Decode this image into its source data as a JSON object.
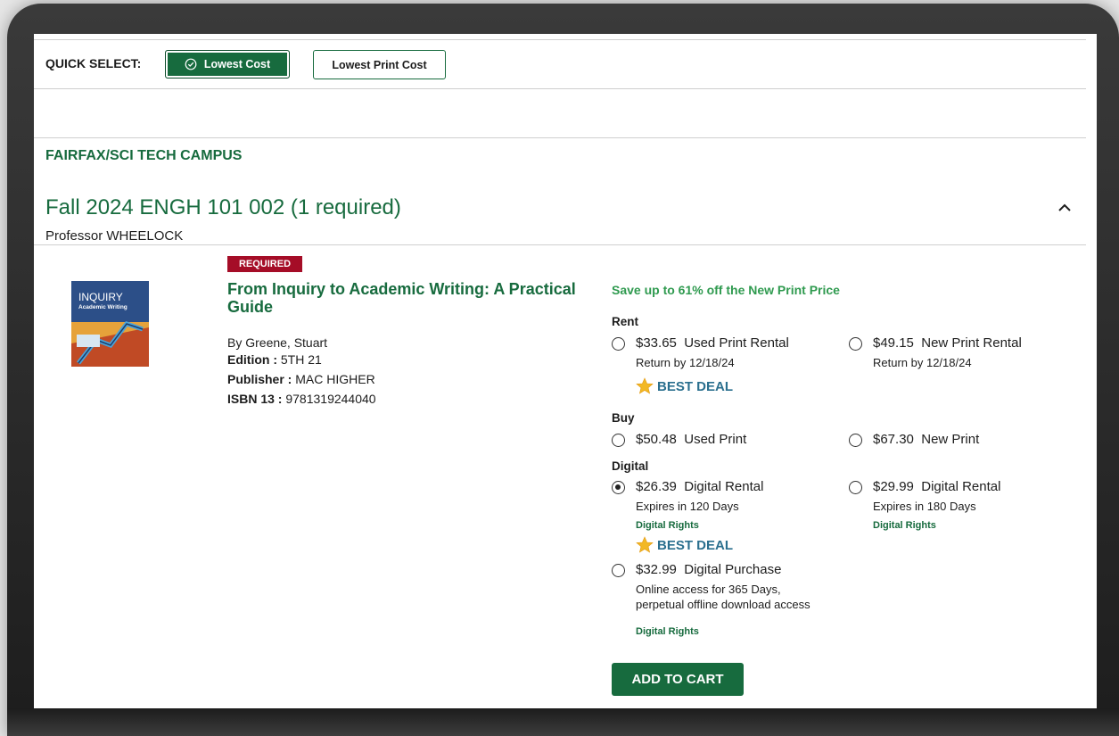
{
  "quick_select": {
    "label": "QUICK SELECT:",
    "lowest_cost_label": "Lowest Cost",
    "lowest_print_label": "Lowest Print Cost"
  },
  "campus": "FAIRFAX/SCI TECH CAMPUS",
  "course": {
    "title": "Fall 2024 ENGH 101 002 (1 required)",
    "professor": "Professor WHEELOCK"
  },
  "book": {
    "badge": "REQUIRED",
    "cover_title": "INQUIRY",
    "cover_subtitle": "Academic Writing",
    "title": "From Inquiry to Academic Writing: A Practical Guide",
    "author": "By  Greene, Stuart",
    "edition_label": "Edition :",
    "edition_value": "5TH 21",
    "publisher_label": "Publisher :",
    "publisher_value": "MAC HIGHER",
    "isbn_label": "ISBN 13 :",
    "isbn_value": "9781319244040"
  },
  "pricing": {
    "save_text": "Save up to 61% off the New Print Price",
    "rent_label": "Rent",
    "buy_label": "Buy",
    "digital_label": "Digital",
    "best_deal": "BEST DEAL",
    "digital_rights": "Digital Rights",
    "options": {
      "used_rental": {
        "price": "$33.65",
        "name": "Used Print Rental",
        "sub": "Return by 12/18/24",
        "selected": false
      },
      "new_rental": {
        "price": "$49.15",
        "name": "New Print Rental",
        "sub": "Return by 12/18/24",
        "selected": false
      },
      "used_print": {
        "price": "$50.48",
        "name": "Used Print",
        "selected": false
      },
      "new_print": {
        "price": "$67.30",
        "name": "New Print",
        "selected": false
      },
      "digital_rental_120": {
        "price": "$26.39",
        "name": "Digital Rental",
        "sub": "Expires in 120 Days",
        "selected": true
      },
      "digital_rental_180": {
        "price": "$29.99",
        "name": "Digital Rental",
        "sub": "Expires in 180 Days",
        "selected": false
      },
      "digital_purchase": {
        "price": "$32.99",
        "name": "Digital Purchase",
        "sub1": "Online access for 365 Days,",
        "sub2": "perpetual offline download access",
        "selected": false
      }
    }
  },
  "add_to_cart": "ADD TO CART",
  "colors": {
    "brand_green": "#176b3e",
    "badge_red": "#a50d27",
    "save_green": "#2f9a4f",
    "best_deal_blue": "#2a6f8e"
  }
}
